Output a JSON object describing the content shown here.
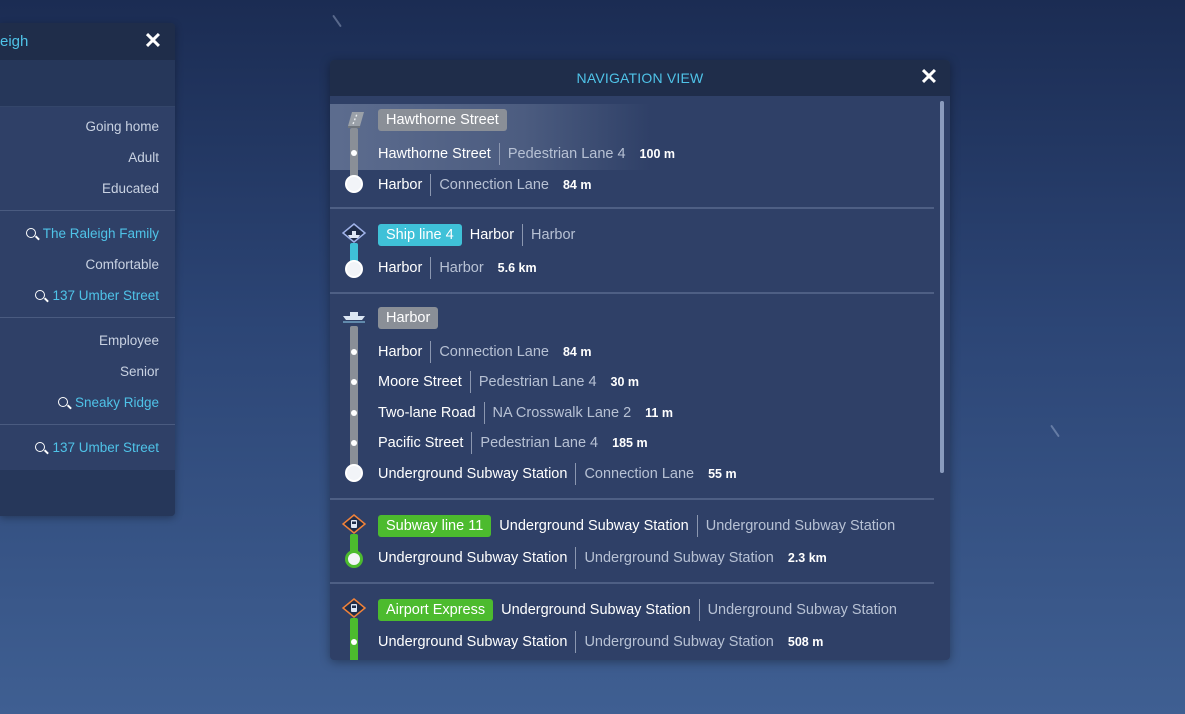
{
  "citizen_panel": {
    "title": "eigh",
    "rows": {
      "goal": "Going home",
      "age": "Adult",
      "education": "Educated",
      "family": "The Raleigh Family",
      "wealth": "Comfortable",
      "home": "137 Umber Street",
      "occupation": "Employee",
      "job_level": "Senior",
      "workplace": "Sneaky Ridge",
      "location": "137 Umber Street"
    }
  },
  "navigation": {
    "title": "NAVIGATION VIEW",
    "legs": [
      {
        "mode_icon": "road-icon",
        "color": "#8a8f97",
        "badge": "Hawthorne Street",
        "steps": [
          {
            "place": "Hawthorne Street",
            "detail": "Pedestrian Lane 4",
            "distance": "100 m"
          },
          {
            "place": "Harbor",
            "detail": "Connection Lane",
            "distance": "84 m"
          }
        ]
      },
      {
        "mode_icon": "ship-icon",
        "color": "#3fc1d8",
        "badge": "Ship line 4",
        "header_place": "Harbor",
        "header_detail": "Harbor",
        "steps": [
          {
            "place": "Harbor",
            "detail": "Harbor",
            "distance": "5.6 km"
          }
        ]
      },
      {
        "mode_icon": "pier-icon",
        "color": "#8a8f97",
        "badge": "Harbor",
        "steps": [
          {
            "place": "Harbor",
            "detail": "Connection Lane",
            "distance": "84 m"
          },
          {
            "place": "Moore Street",
            "detail": "Pedestrian Lane 4",
            "distance": "30 m"
          },
          {
            "place": "Two-lane Road",
            "detail": "NA Crosswalk Lane 2",
            "distance": "11 m"
          },
          {
            "place": "Pacific Street",
            "detail": "Pedestrian Lane 4",
            "distance": "185 m"
          },
          {
            "place": "Underground Subway Station",
            "detail": "Connection Lane",
            "distance": "55 m"
          }
        ]
      },
      {
        "mode_icon": "subway-icon",
        "color": "#4cbb2e",
        "badge": "Subway line 11",
        "header_place": "Underground Subway Station",
        "header_detail": "Underground Subway Station",
        "steps": [
          {
            "place": "Underground Subway Station",
            "detail": "Underground Subway Station",
            "distance": "2.3 km"
          }
        ]
      },
      {
        "mode_icon": "subway-icon",
        "color": "#4cbb2e",
        "badge": "Airport Express",
        "header_place": "Underground Subway Station",
        "header_detail": "Underground Subway Station",
        "steps": [
          {
            "place": "Underground Subway Station",
            "detail": "Underground Subway Station",
            "distance": "508 m"
          }
        ]
      }
    ]
  }
}
